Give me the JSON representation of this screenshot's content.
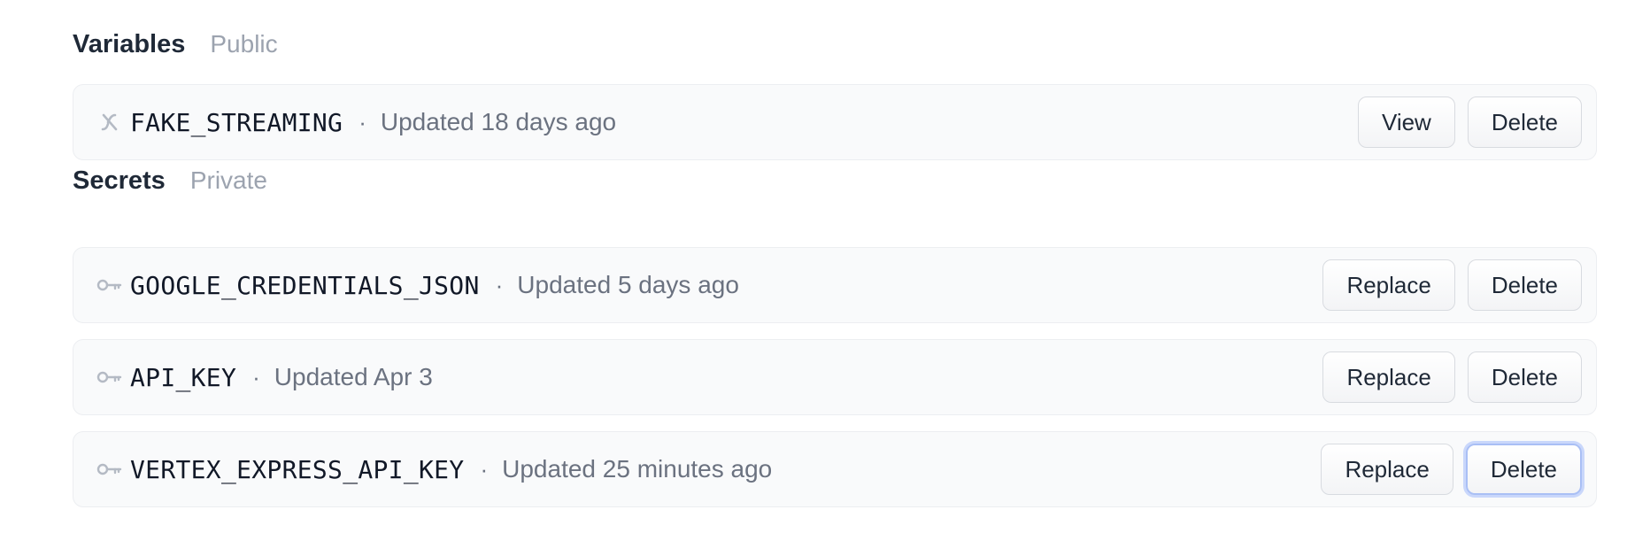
{
  "variables": {
    "title": "Variables",
    "subtitle": "Public",
    "items": [
      {
        "icon": "variable-icon",
        "name": "FAKE_STREAMING",
        "separator": "·",
        "updated": "Updated 18 days ago",
        "primary_action": "View",
        "delete_action": "Delete"
      }
    ]
  },
  "secrets": {
    "title": "Secrets",
    "subtitle": "Private",
    "items": [
      {
        "icon": "key-icon",
        "name": "GOOGLE_CREDENTIALS_JSON",
        "separator": "·",
        "updated": "Updated 5 days ago",
        "primary_action": "Replace",
        "delete_action": "Delete"
      },
      {
        "icon": "key-icon",
        "name": "API_KEY",
        "separator": "·",
        "updated": "Updated Apr 3",
        "primary_action": "Replace",
        "delete_action": "Delete"
      },
      {
        "icon": "key-icon",
        "name": "VERTEX_EXPRESS_API_KEY",
        "separator": "·",
        "updated": "Updated 25 minutes ago",
        "primary_action": "Replace",
        "delete_action": "Delete",
        "delete_focused": true
      }
    ]
  },
  "colors": {
    "focus_ring": "#a9bff5",
    "row_background": "#f9fafb",
    "muted_text": "#9ca3af"
  }
}
